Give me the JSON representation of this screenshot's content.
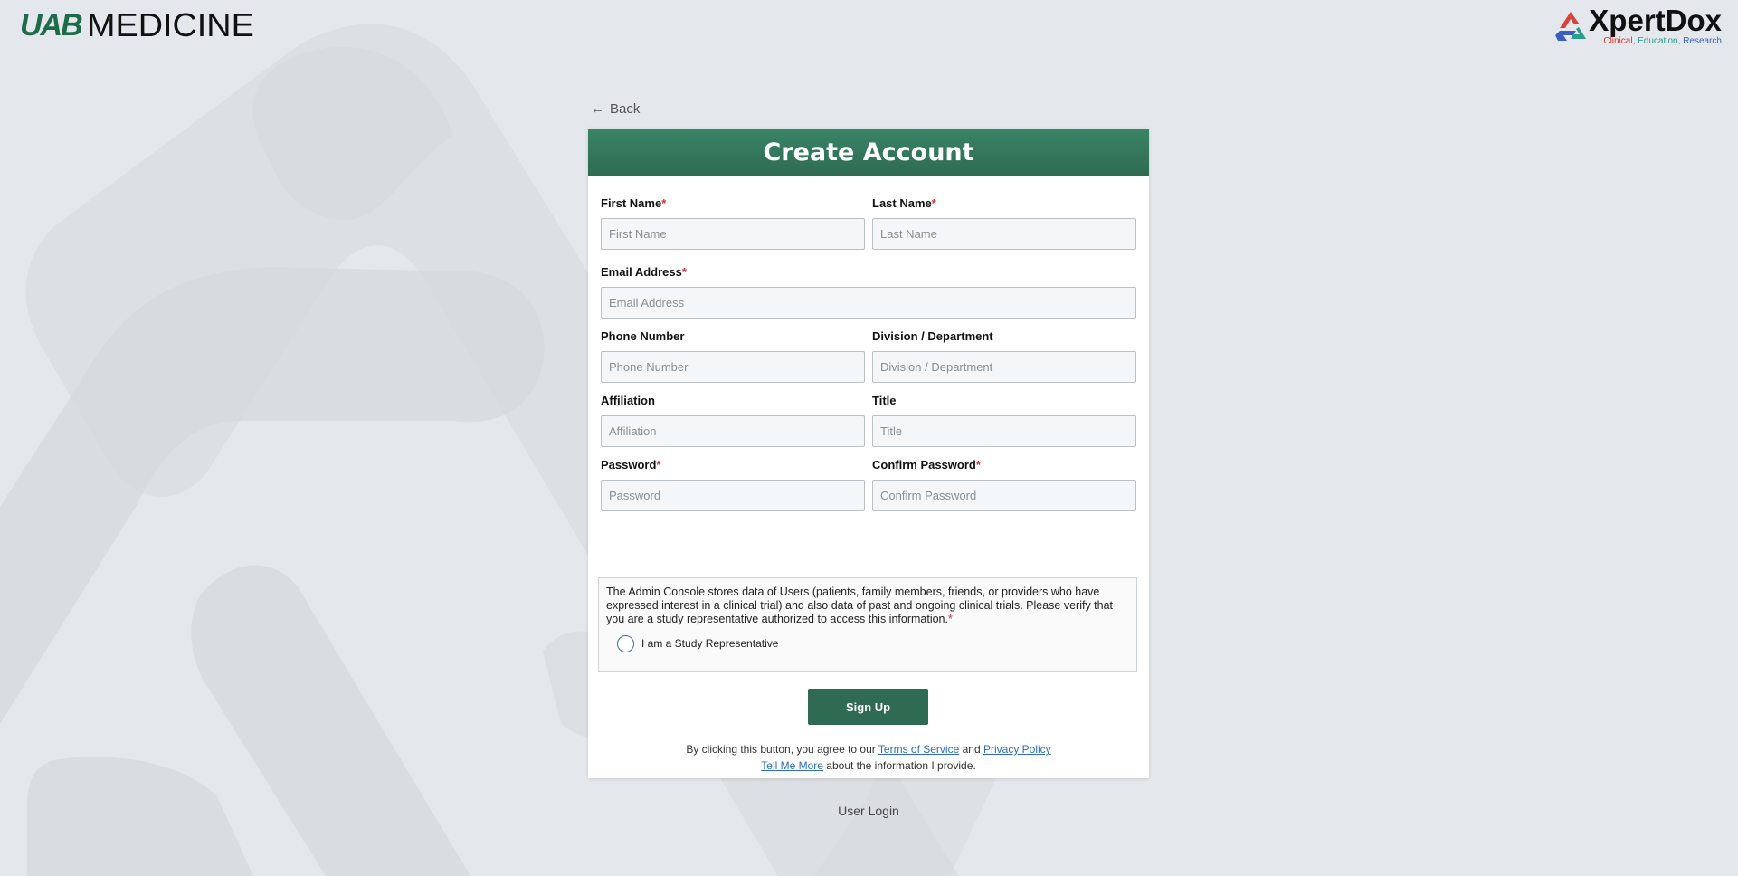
{
  "brand_left": {
    "mark": "UAB",
    "word": "MEDICINE"
  },
  "brand_right": {
    "name": "XpertDox",
    "tag_1": "Clinical,",
    "tag_2": "Education,",
    "tag_3": "Research"
  },
  "back": {
    "arrow": "←",
    "label": "Back"
  },
  "card": {
    "title": "Create Account"
  },
  "fields": {
    "first_name": {
      "label": "First Name",
      "required": "*",
      "placeholder": "First Name"
    },
    "last_name": {
      "label": "Last Name",
      "required": "*",
      "placeholder": "Last Name"
    },
    "email": {
      "label": "Email Address",
      "required": "*",
      "placeholder": "Email Address"
    },
    "phone": {
      "label": "Phone Number",
      "placeholder": "Phone Number"
    },
    "division": {
      "label": "Division / Department",
      "placeholder": "Division / Department"
    },
    "affiliation": {
      "label": "Affiliation",
      "placeholder": "Affiliation"
    },
    "title": {
      "label": "Title",
      "placeholder": "Title"
    },
    "password": {
      "label": "Password",
      "required": "*",
      "placeholder": "Password"
    },
    "confirm_password": {
      "label": "Confirm Password",
      "required": "*",
      "placeholder": "Confirm Password"
    }
  },
  "consent": {
    "text": "The Admin Console stores data of Users (patients, family members, friends, or providers who have expressed interest in a clinical trial) and also data of past and ongoing clinical trials. Please verify that you are a study representative authorized to access this information.",
    "required": "*",
    "radio_label": "I am a Study Representative"
  },
  "signup_label": "Sign Up",
  "terms": {
    "prefix": "By clicking this button, you agree to our",
    "tos": "Terms of Service",
    "and": "and",
    "privacy": "Privacy Policy",
    "tell_more": "Tell Me More",
    "suffix": "about the information I provide."
  },
  "user_login": "User Login",
  "colors": {
    "accent": "#2e6b52",
    "link": "#2a6fb8",
    "required": "#d32f2f"
  }
}
